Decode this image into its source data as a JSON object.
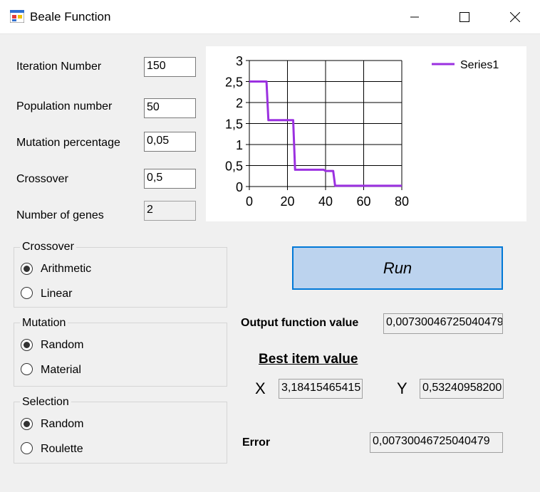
{
  "window": {
    "title": "Beale Function"
  },
  "params": [
    {
      "label": "Iteration Number",
      "value": "150"
    },
    {
      "label": "Population number",
      "value": "50"
    },
    {
      "label": "Mutation percentage",
      "value": "0,05"
    },
    {
      "label": "Crossover",
      "value": "0,5"
    },
    {
      "label": "Number of genes",
      "value": "2"
    }
  ],
  "groups": {
    "crossover": {
      "title": "Crossover",
      "options": [
        "Arithmetic",
        "Linear"
      ],
      "selected": 0
    },
    "mutation": {
      "title": "Mutation",
      "options": [
        "Random",
        "Material"
      ],
      "selected": 0
    },
    "selection": {
      "title": "Selection",
      "options": [
        "Random",
        "Roulette"
      ],
      "selected": 0
    }
  },
  "run_label": "Run",
  "output": {
    "label": "Output function value",
    "value": "0,00730046725040479"
  },
  "best": {
    "heading": "Best item value",
    "x_label": "X",
    "x_value": "3,18415465415",
    "y_label": "Y",
    "y_value": "0,53240958200"
  },
  "error": {
    "label": "Error",
    "value": "0,00730046725040479"
  },
  "chart_data": {
    "type": "line",
    "title": "",
    "xlabel": "",
    "ylabel": "",
    "xlim": [
      0,
      80
    ],
    "ylim": [
      0,
      3
    ],
    "x_ticks": [
      "0",
      "20",
      "40",
      "60",
      "80"
    ],
    "y_ticks": [
      "0",
      "0,5",
      "1",
      "1,5",
      "2",
      "2,5",
      "3"
    ],
    "grid": true,
    "legend": "top-right",
    "series": [
      {
        "name": "Series1",
        "color": "#9b30e0",
        "x": [
          0,
          9,
          10,
          18,
          23,
          24,
          39,
          40,
          44,
          45,
          80
        ],
        "y": [
          2.5,
          2.5,
          1.58,
          1.58,
          1.58,
          0.4,
          0.4,
          0.37,
          0.37,
          0.02,
          0.02
        ]
      }
    ]
  }
}
